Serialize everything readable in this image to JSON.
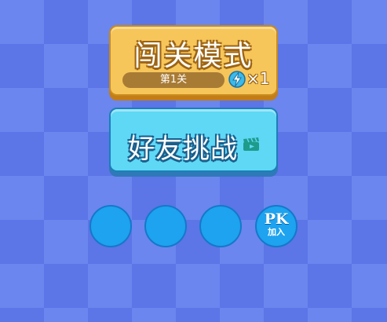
{
  "challenge_mode": {
    "title": "闯关模式",
    "level_label": "第1关",
    "energy_icon": "lightning-energy-icon",
    "energy_count": "×1"
  },
  "friend_challenge": {
    "title": "好友挑战",
    "icon": "video-clapper-icon"
  },
  "players": {
    "slots": 3,
    "pk_label": "PK",
    "join_label": "加入"
  },
  "colors": {
    "background": "#6b86ee",
    "challenge_button": "#f6c65a",
    "friend_button": "#5fd8f6",
    "slot": "#1da3ef"
  }
}
